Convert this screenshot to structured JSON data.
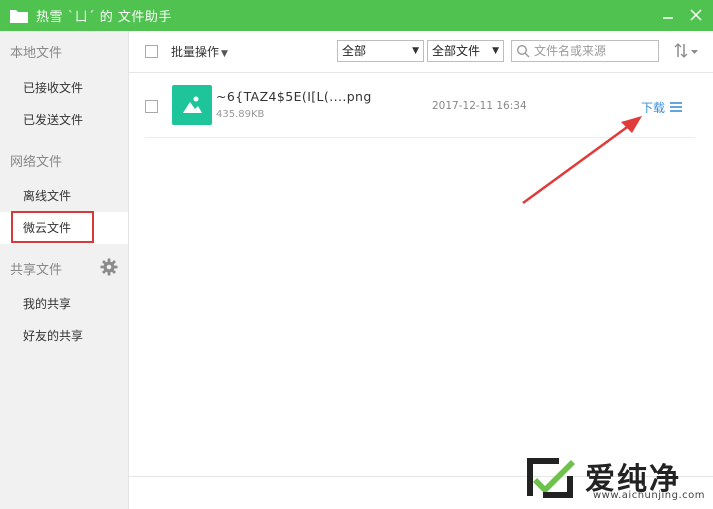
{
  "window": {
    "title": "热雪 `ㄩ´ 的 文件助手"
  },
  "sidebar": {
    "local_section": "本地文件",
    "received": "已接收文件",
    "sent": "已发送文件",
    "network_section": "网络文件",
    "offline": "离线文件",
    "weiyun": "微云文件",
    "shared_section": "共享文件",
    "my_shares": "我的共享",
    "friend_shares": "好友的共享"
  },
  "toolbar": {
    "batch_label": "批量操作",
    "filter_scope": "全部",
    "filter_type": "全部文件",
    "search_placeholder": "文件名或来源"
  },
  "files": [
    {
      "name": "~6{TAZ4$5E(I[L(....png",
      "size": "435.89KB",
      "date": "2017-12-11 16:34",
      "action": "下载"
    }
  ],
  "watermark": {
    "brand": "爱纯净",
    "url": "www.aichunjing.com"
  },
  "colors": {
    "titlebar": "#4fc24f",
    "accent_link": "#3b8fd8",
    "thumb": "#1ec59a",
    "highlight": "#d6393a"
  }
}
